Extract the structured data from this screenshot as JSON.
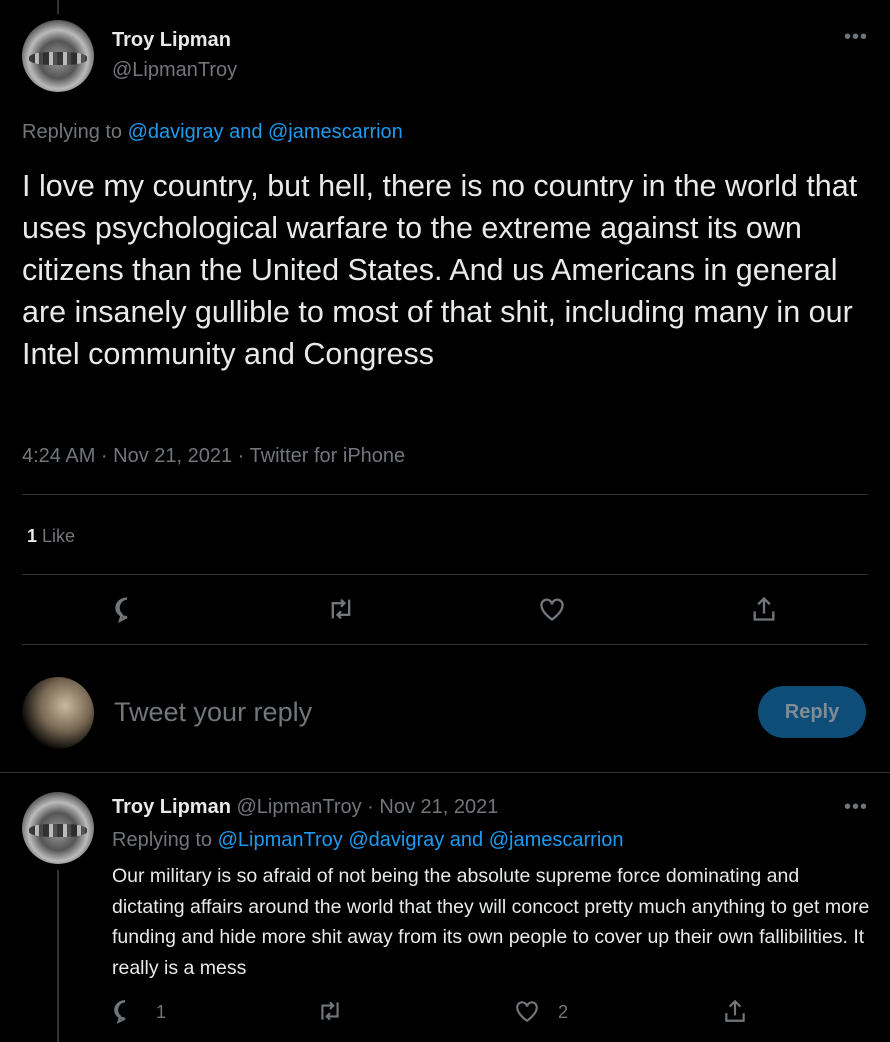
{
  "main_tweet": {
    "author_name": "Troy Lipman",
    "author_handle": "@LipmanTroy",
    "replying_label": "Replying to",
    "replying_to": "@davigray and @jamescarrion",
    "text": "I love my country, but hell, there is no country in the world that uses psychological warfare to the extreme against its own citizens than the United States. And us Americans in general are insanely gullible to most of that shit, including many in our Intel community and Congress",
    "meta": "4:24 AM · Nov 21, 2021 · Twitter for iPhone",
    "likes_count": "1",
    "likes_label": "Like"
  },
  "composer": {
    "placeholder": "Tweet your reply",
    "reply_button": "Reply"
  },
  "reply_tweet": {
    "author_name": "Troy Lipman",
    "author_handle_date": "@LipmanTroy · Nov 21, 2021",
    "replying_label": "Replying to",
    "replying_to": "@LipmanTroy @davigray and @jamescarrion",
    "text": "Our military is so afraid of not being the absolute supreme force dominating and dictating affairs around the world that they will concoct pretty much anything to get more funding and hide more shit away from its own people to cover up their own fallibilities. It really is a mess",
    "reply_count": "1",
    "like_count": "2"
  },
  "colors": {
    "accent": "#1d9bf0",
    "background": "#000000",
    "muted": "#71767b"
  }
}
